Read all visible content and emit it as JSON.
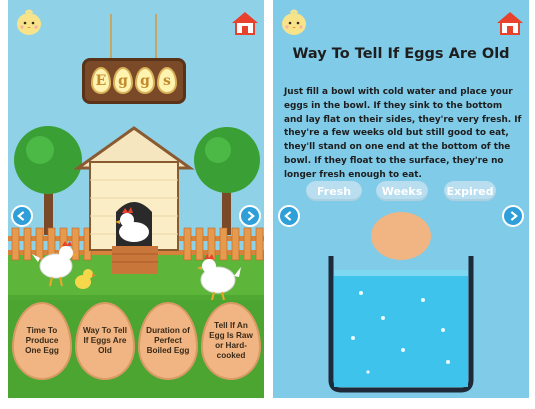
{
  "screens": [
    {
      "name": "home",
      "sign_letters": [
        "E",
        "g",
        "g",
        "s"
      ],
      "menu": [
        {
          "label": "Time To Produce One Egg"
        },
        {
          "label": "Way To Tell If Eggs Are Old"
        },
        {
          "label": "Duration of Perfect Boiled Egg"
        },
        {
          "label": "Tell If An Egg Is Raw or Hard-cooked"
        }
      ],
      "icons": {
        "top_left": "chick-face-icon",
        "top_right": "home-icon",
        "left_arrow": "arrow-left-icon",
        "right_arrow": "arrow-right-icon"
      }
    },
    {
      "name": "eggs-old",
      "title": "Way To Tell If Eggs Are Old",
      "body": "Just fill a bowl with cold water and place your eggs in the bowl. If they sink to the bottom and lay flat on their sides, they're very fresh. If they're a few weeks old but still good to eat, they'll stand on one end at the bottom of the bowl. If they float to the surface, they're no longer fresh enough to eat.",
      "tabs": [
        {
          "label": "Fresh"
        },
        {
          "label": "Weeks"
        },
        {
          "label": "Expired"
        }
      ],
      "icons": {
        "top_left": "chick-face-icon",
        "top_right": "home-icon",
        "left_arrow": "arrow-left-icon",
        "right_arrow": "arrow-right-icon"
      }
    }
  ],
  "colors": {
    "sky_left": "#8fd2e8",
    "sky_right": "#7fcbe8",
    "grass": "#5db53a",
    "fence": "#d8833c",
    "egg_button": "#f0b582",
    "arrow_blue": "#2e9fd9",
    "water": "#3ec3ec"
  }
}
